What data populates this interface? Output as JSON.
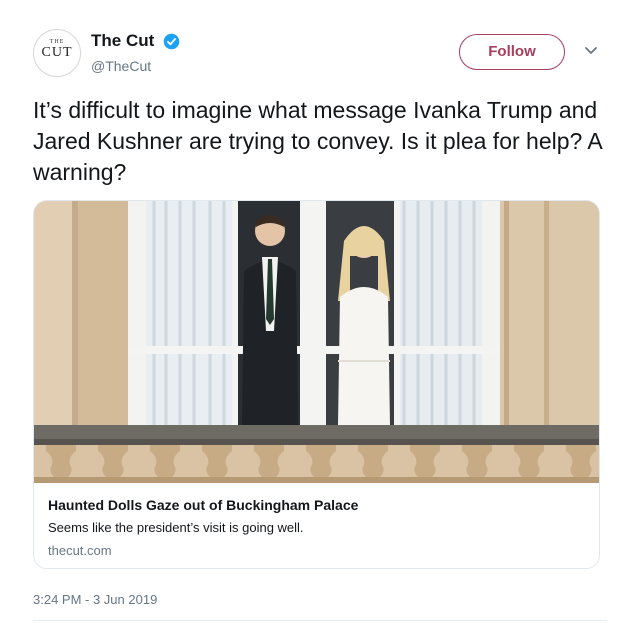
{
  "account": {
    "avatar_small_text": "THE",
    "avatar_large_text": "CUT",
    "name": "The Cut",
    "handle": "@TheCut",
    "verified": true
  },
  "follow_label": "Follow",
  "menu_icon": "chevron-down-icon",
  "tweet_text": "It’s difficult to imagine what message Ivanka Trump and Jared Kushner are trying to convey. Is it plea for help? A warning?",
  "card": {
    "title": "Haunted Dolls Gaze out of Buckingham Palace",
    "description": "Seems like the president’s visit is going well.",
    "domain": "thecut.com"
  },
  "timestamp": "3:24 PM - 3 Jun 2019",
  "colors": {
    "follow_accent": "#a83f5c",
    "verified_blue": "#1da1f2",
    "muted_text": "#657786"
  }
}
